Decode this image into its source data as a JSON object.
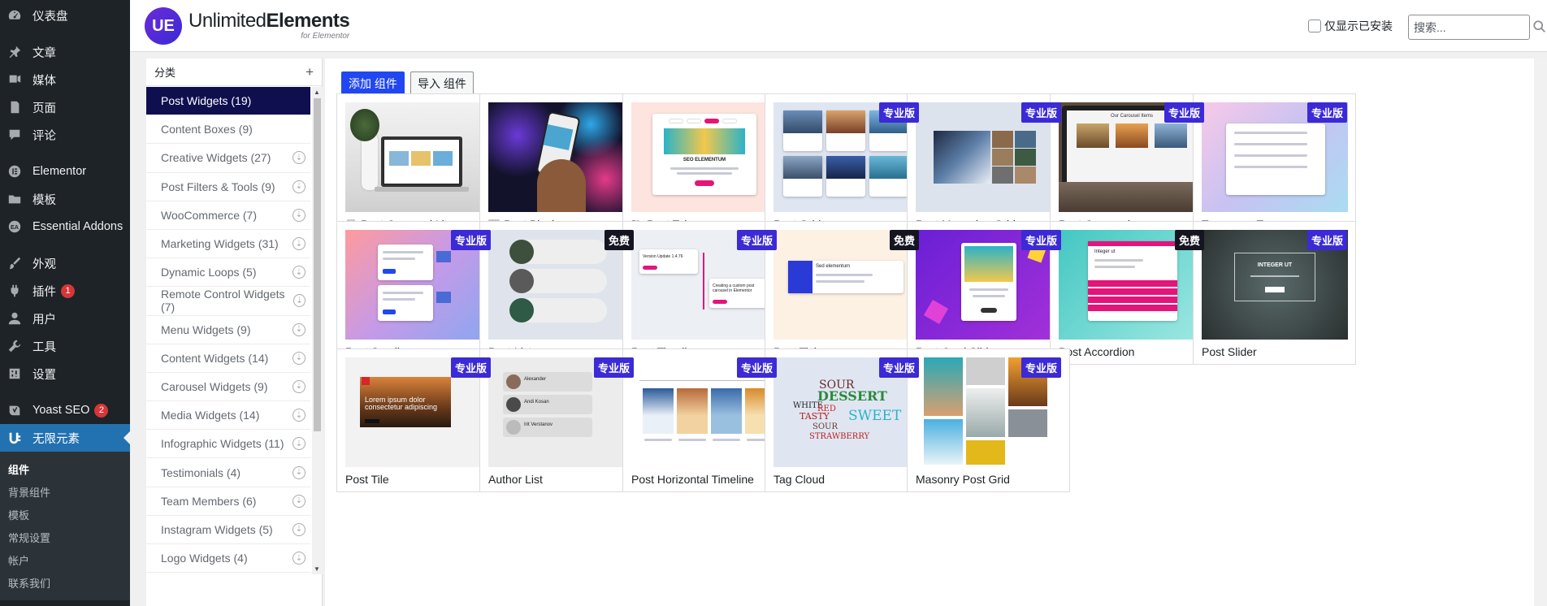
{
  "sidebar": {
    "items": [
      {
        "label": "仪表盘",
        "icon": "dashboard-icon"
      },
      {
        "label": "文章",
        "icon": "pin-icon"
      },
      {
        "label": "媒体",
        "icon": "media-icon"
      },
      {
        "label": "页面",
        "icon": "page-icon"
      },
      {
        "label": "评论",
        "icon": "comment-icon"
      },
      {
        "label": "Elementor",
        "icon": "elementor-icon"
      },
      {
        "label": "模板",
        "icon": "folder-icon"
      },
      {
        "label": "Essential Addons",
        "icon": "ea-icon"
      },
      {
        "label": "外观",
        "icon": "brush-icon"
      },
      {
        "label": "插件",
        "icon": "plugin-icon",
        "badge": "1"
      },
      {
        "label": "用户",
        "icon": "user-icon"
      },
      {
        "label": "工具",
        "icon": "wrench-icon"
      },
      {
        "label": "设置",
        "icon": "settings-icon"
      },
      {
        "label": "Yoast SEO",
        "icon": "yoast-icon",
        "badge": "2"
      },
      {
        "label": "无限元素",
        "icon": "ue-icon"
      }
    ],
    "submenu": [
      "组件",
      "背景组件",
      "模板",
      "常规设置",
      "帐户",
      "联系我们"
    ]
  },
  "header": {
    "logo_title_light": "Unlimited",
    "logo_title_bold": "Elements",
    "logo_sub": "for Elementor",
    "logo_mark": "UE",
    "installed_only_label": "仅显示已安装",
    "search_placeholder": "搜索..."
  },
  "categories": {
    "header": "分类",
    "add": "+",
    "items": [
      "Post Widgets (19)",
      "Content Boxes (9)",
      "Creative Widgets (27)",
      "Post Filters & Tools (9)",
      "WooCommerce (7)",
      "Marketing Widgets (31)",
      "Dynamic Loops (5)",
      "Remote Control Widgets (7)",
      "Menu Widgets (9)",
      "Content Widgets (14)",
      "Carousel Widgets (9)",
      "Media Widgets (14)",
      "Infographic Widgets (11)",
      "Testimonials (4)",
      "Team Members (6)",
      "Instagram Widgets (5)",
      "Logo Widgets (4)"
    ]
  },
  "toolbar": {
    "add_label": "添加 组件",
    "import_label": "导入 组件"
  },
  "widgets": [
    {
      "name": "Post Carousel Lite",
      "tag": ""
    },
    {
      "name": "Post Blocks",
      "tag": ""
    },
    {
      "name": "Post Tabs",
      "tag": ""
    },
    {
      "name": "Post Grid",
      "tag": "专业版"
    },
    {
      "name": "Post Magazine Grid",
      "tag": "专业版"
    },
    {
      "name": "Post Carousel",
      "tag": "专业版"
    },
    {
      "name": "Taxonomy Terms",
      "tag": "专业版"
    },
    {
      "name": "Post Scroll",
      "tag": "专业版"
    },
    {
      "name": "Post List",
      "tag": "免费"
    },
    {
      "name": "Post Timeline",
      "tag": "专业版"
    },
    {
      "name": "Post Ticker",
      "tag": "免费"
    },
    {
      "name": "Post Card Slider",
      "tag": "专业版"
    },
    {
      "name": "Post Accordion",
      "tag": "免费"
    },
    {
      "name": "Post Slider",
      "tag": "专业版"
    },
    {
      "name": "Post Tile",
      "tag": "专业版"
    },
    {
      "name": "Author List",
      "tag": "专业版"
    },
    {
      "name": "Post Horizontal Timeline",
      "tag": "专业版"
    },
    {
      "name": "Tag Cloud",
      "tag": "专业版"
    },
    {
      "name": "Masonry Post Grid",
      "tag": "专业版"
    }
  ],
  "thumb_text": {
    "tabs_title": "SEO ELEMENTUM",
    "timeline_a": "Version Update 1.4.76",
    "timeline_b": "Creating a custom post carousel in Elementor",
    "ticker_title": "Sed elementum",
    "slider_title": "INTEGER UT",
    "accordion_title": "Integer ut",
    "tile_text": "Lorem ipsum dolor consectetur adipiscing",
    "authors": [
      "Alexander",
      "Andi Kosan",
      "Irit Verstanov"
    ],
    "cloud": [
      "SOUR",
      "DESSERT",
      "WHITE",
      "TASTY",
      "RED",
      "SWEET",
      "SOUR",
      "STRAWBERRY"
    ],
    "carousel_header": "Our Carousel Items"
  },
  "colors": {
    "admin_bg": "#1d2327",
    "accent": "#2271b1",
    "active_category": "#0f0f50",
    "primary_button": "#2147f3",
    "pro_tag": "#3b2ad6",
    "free_tag": "#151522"
  }
}
